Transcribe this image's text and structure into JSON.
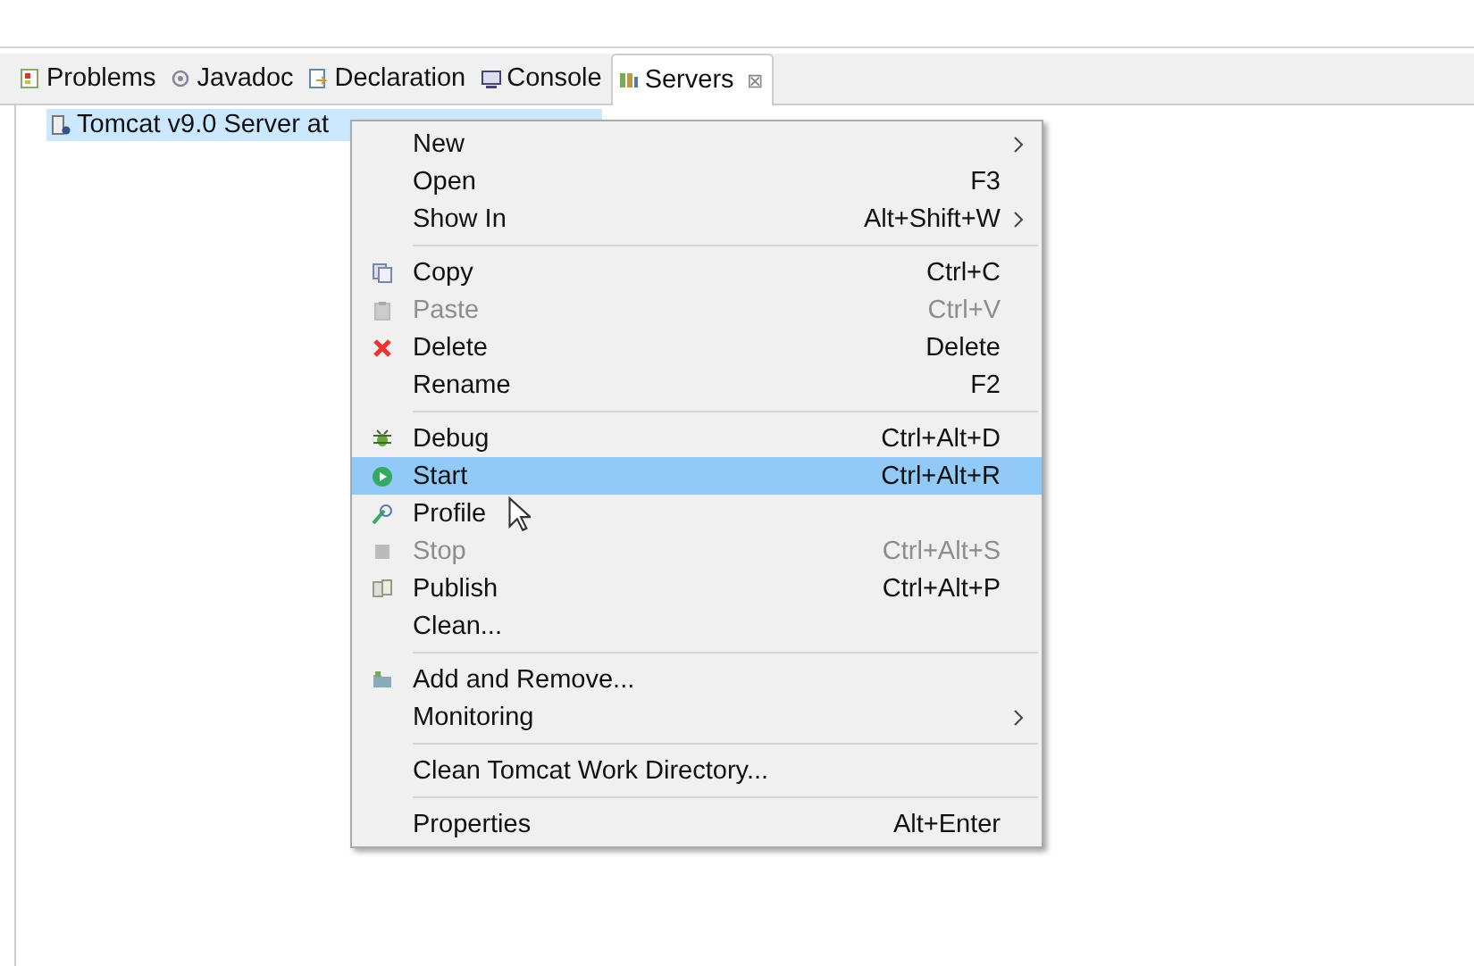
{
  "tabs": [
    {
      "label": "Problems",
      "selected": false
    },
    {
      "label": "Javadoc",
      "selected": false
    },
    {
      "label": "Declaration",
      "selected": false
    },
    {
      "label": "Console",
      "selected": false
    },
    {
      "label": "Servers",
      "selected": true,
      "close": "⊠"
    }
  ],
  "servers": [
    {
      "label": "Tomcat v9.0 Server at",
      "selected": true
    }
  ],
  "context_menu": [
    {
      "kind": "item",
      "label": "New",
      "submenu": true,
      "disabled": false,
      "selected": false
    },
    {
      "kind": "item",
      "label": "Open",
      "shortcut": "F3",
      "disabled": false,
      "selected": false
    },
    {
      "kind": "item",
      "label": "Show In",
      "shortcut": "Alt+Shift+W",
      "submenu": true,
      "disabled": false,
      "selected": false
    },
    {
      "kind": "separator"
    },
    {
      "kind": "item",
      "label": "Copy",
      "shortcut": "Ctrl+C",
      "disabled": false,
      "selected": false
    },
    {
      "kind": "item",
      "label": "Paste",
      "shortcut": "Ctrl+V",
      "disabled": true,
      "selected": false
    },
    {
      "kind": "item",
      "label": "Delete",
      "shortcut": "Delete",
      "disabled": false,
      "selected": false
    },
    {
      "kind": "item",
      "label": "Rename",
      "shortcut": "F2",
      "disabled": false,
      "selected": false
    },
    {
      "kind": "separator"
    },
    {
      "kind": "item",
      "label": "Debug",
      "shortcut": "Ctrl+Alt+D",
      "disabled": false,
      "selected": false
    },
    {
      "kind": "item",
      "label": "Start",
      "shortcut": "Ctrl+Alt+R",
      "disabled": false,
      "selected": true
    },
    {
      "kind": "item",
      "label": "Profile",
      "disabled": false,
      "selected": false
    },
    {
      "kind": "item",
      "label": "Stop",
      "shortcut": "Ctrl+Alt+S",
      "disabled": true,
      "selected": false
    },
    {
      "kind": "item",
      "label": "Publish",
      "shortcut": "Ctrl+Alt+P",
      "disabled": false,
      "selected": false
    },
    {
      "kind": "item",
      "label": "Clean...",
      "disabled": false,
      "selected": false
    },
    {
      "kind": "separator"
    },
    {
      "kind": "item",
      "label": "Add and Remove...",
      "disabled": false,
      "selected": false
    },
    {
      "kind": "item",
      "label": "Monitoring",
      "submenu": true,
      "disabled": false,
      "selected": false
    },
    {
      "kind": "separator"
    },
    {
      "kind": "item",
      "label": "Clean Tomcat Work Directory...",
      "disabled": false,
      "selected": false
    },
    {
      "kind": "separator"
    },
    {
      "kind": "item",
      "label": "Properties",
      "shortcut": "Alt+Enter",
      "disabled": false,
      "selected": false
    }
  ]
}
